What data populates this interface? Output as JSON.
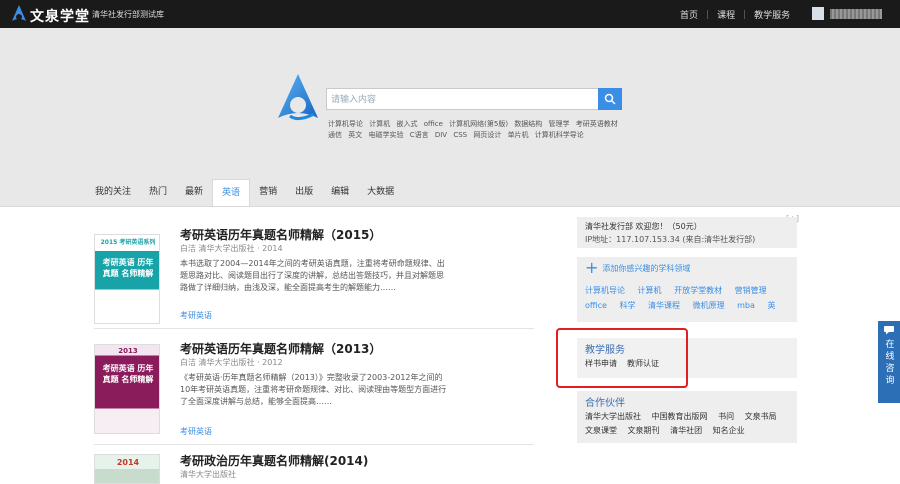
{
  "header": {
    "logo_text": "文泉学堂",
    "slogan": "清华社发行部测试库",
    "nav": [
      "首页",
      "课程",
      "教学服务"
    ],
    "user_name": "██████",
    "bg_color": "#1a1a1a"
  },
  "search": {
    "placeholder": "请输入内容",
    "hot_tags": [
      "计算机导论",
      "计算机",
      "嵌入式",
      "office",
      "计算机网络(第5版)",
      "数据结构",
      "管理学",
      "考研英语教材",
      "通信",
      "英文",
      "电磁学实验",
      "C语言",
      "DIV",
      "CSS",
      "网页设计",
      "单片机",
      "计算机科学导论"
    ],
    "accent_color": "#3a8ee6"
  },
  "tabs": {
    "items": [
      "我的关注",
      "热门",
      "最新",
      "英语",
      "营销",
      "出版",
      "编辑",
      "大数据"
    ],
    "active_index": 3,
    "extra": "[+]"
  },
  "books": [
    {
      "title": "考研英语历年真题名师精解（2015）",
      "meta": "白洁 清华大学出版社 · 2014",
      "desc": "本书选取了2004—2014年之间的考研英语真题，注重将考研命题规律、出题思路对比、阅读题目出行了深度的讲解，总结出答题技巧，并且对解题思路做了详细归纳，由浅及深，能全面提高考生的解题能力……",
      "tag": "考研英语",
      "cover_top": "2015 考研英语系列",
      "cover_mid": "考研英语 历年真题 名师精解"
    },
    {
      "title": "考研英语历年真题名师精解（2013）",
      "meta": "白洁 清华大学出版社 · 2012",
      "desc": "《考研英语·历年真题名师精解（2013）》完整收录了2003-2012年之间的10年考研英语真题，注重将考研命题规律、对比、阅读理由等题型方面进行了全面深度讲解与总结，能够全面提高……",
      "tag": "考研英语",
      "cover_top": "2013",
      "cover_mid": "考研英语 历年真题 名师精解"
    },
    {
      "title": "考研政治历年真题名师精解(2014)",
      "meta": "清华大学出版社",
      "desc": "",
      "tag": "",
      "cover_top": "2014",
      "cover_mid": ""
    }
  ],
  "sidebar": {
    "user_line1": "清华社发行部 欢迎您！（50元）",
    "user_line2": "IP地址：117.107.153.34 (来自:清华社发行部)",
    "add_interest": "添加你感兴趣的学科领域",
    "interest_tags": [
      "计算机导论",
      "计算机",
      "开放学堂教材",
      "营销管理",
      "office",
      "科学",
      "清华课程",
      "微机原理",
      "mba",
      "英"
    ],
    "teaching_title": "教学服务",
    "teaching_links": [
      "样书申请",
      "教师认证"
    ],
    "partner_title": "合作伙伴",
    "partners": [
      "清华大学出版社",
      "中国教育出版网",
      "书问",
      "文泉书局",
      "文泉课堂",
      "文泉期刊",
      "清华社团",
      "知名企业"
    ]
  },
  "feedback": {
    "label": "在线咨询"
  }
}
